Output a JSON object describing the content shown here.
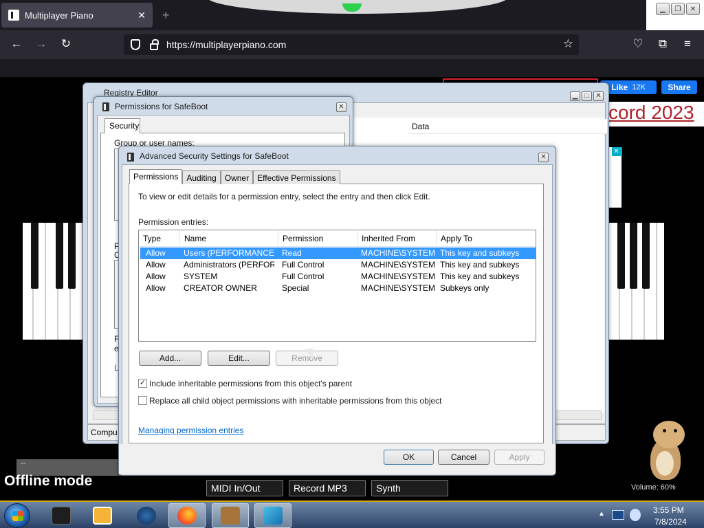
{
  "browser": {
    "tab_title": "Multiplayer Piano",
    "tab_close": "✕",
    "new_tab": "+",
    "url": "https://multiplayerpiano.com",
    "back_icon": "←",
    "forward_icon": "→",
    "reload_icon": "↻",
    "star_icon": "☆",
    "pocket_icon": "♡",
    "extensions_icon": "⧉",
    "menu_icon": "≡"
  },
  "page": {
    "fb_like_label": "Like",
    "fb_like_count": "12K",
    "fb_share_label": "Share",
    "record_banner": "cord 2023",
    "ad_close": "✕",
    "offline_mode": "Offline mode",
    "offline_bar_text": "--",
    "buttons": [
      "MIDI In/Out",
      "Record MP3",
      "Synth"
    ],
    "volume": "Volume: 60%"
  },
  "back_window": {
    "title": "Registry Editor",
    "column_data": "Data",
    "status": "Compu"
  },
  "perm_window": {
    "title": "Permissions for SafeBoot",
    "tab": "Security",
    "group_label": "Group or user names:",
    "frag_r1": "P",
    "frag_c": "C",
    "frag_f": "F",
    "frag_ed": "ed",
    "frag_l": "L"
  },
  "adv_window": {
    "title": "Advanced Security Settings for SafeBoot",
    "tabs": [
      "Permissions",
      "Auditing",
      "Owner",
      "Effective Permissions"
    ],
    "instruction": "To view or edit details for a permission entry, select the entry and then click Edit.",
    "entries_label": "Permission entries:",
    "columns": [
      "Type",
      "Name",
      "Permission",
      "Inherited From",
      "Apply To"
    ],
    "rows": [
      [
        "Allow",
        "Users (PERFORMANCE\\...",
        "Read",
        "MACHINE\\SYSTEM",
        "This key and subkeys"
      ],
      [
        "Allow",
        "Administrators (PERFOR...",
        "Full Control",
        "MACHINE\\SYSTEM",
        "This key and subkeys"
      ],
      [
        "Allow",
        "SYSTEM",
        "Full Control",
        "MACHINE\\SYSTEM",
        "This key and subkeys"
      ],
      [
        "Allow",
        "CREATOR OWNER",
        "Special",
        "MACHINE\\SYSTEM",
        "Subkeys only"
      ]
    ],
    "add_button": "Add...",
    "edit_button": "Edit...",
    "remove_button": "Remove",
    "include_inheritable": "Include inheritable permissions from this object's parent",
    "include_checked": "✓",
    "replace_child": "Replace all child object permissions with inheritable permissions from this object",
    "managing_link": "Managing permission entries",
    "ok_button": "OK",
    "cancel_button": "Cancel",
    "apply_button": "Apply"
  },
  "taskbar": {
    "time": "3:55 PM",
    "date": "7/8/2024"
  },
  "colors": {
    "selection": "#3399ff",
    "link": "#0066cc",
    "fb_blue": "#1877f2",
    "banner_red": "#b0202a"
  }
}
